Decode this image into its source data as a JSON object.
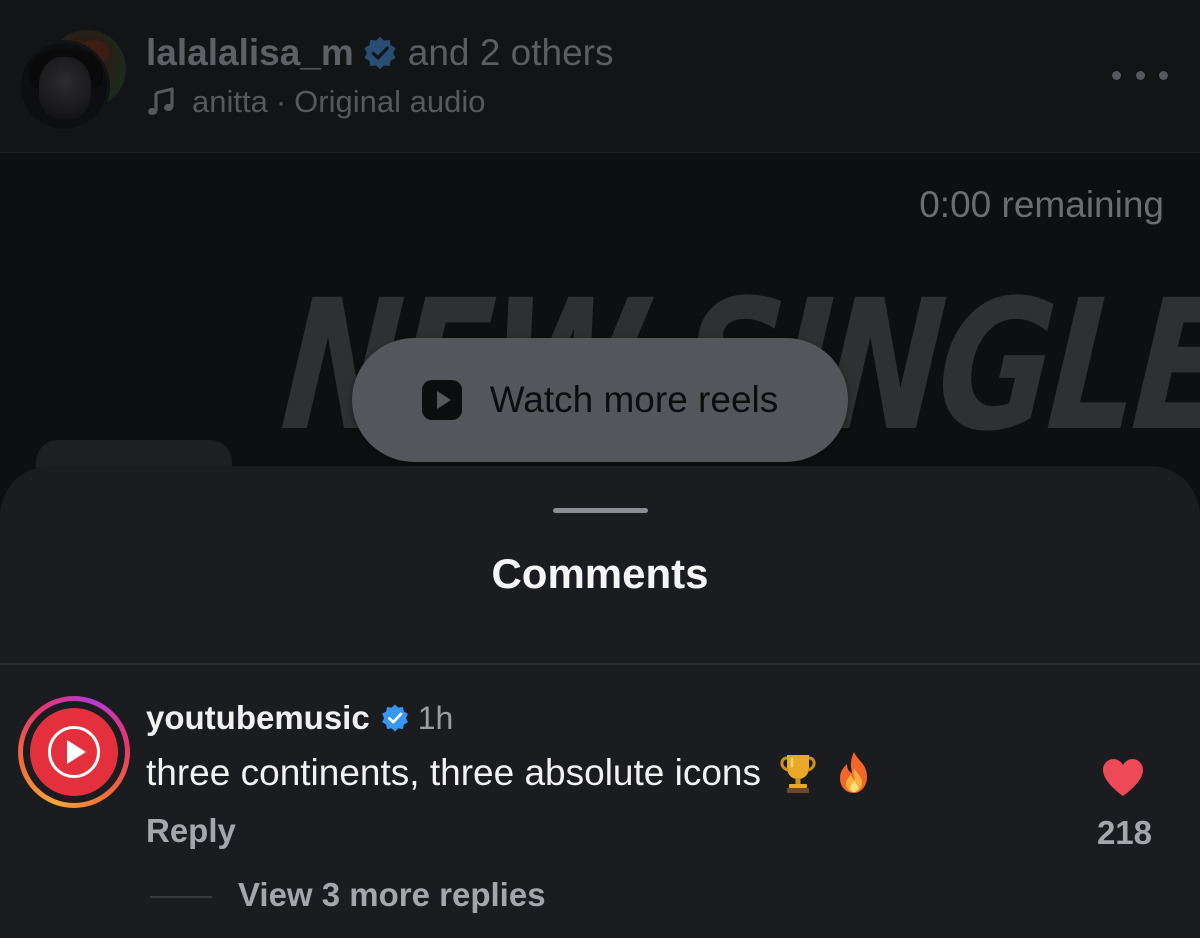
{
  "reel_header": {
    "username": "lalalalisa_m",
    "others_text": "and 2 others",
    "audio_artist": "anitta",
    "audio_separator": "·",
    "audio_title": "Original audio"
  },
  "video": {
    "remaining_text": "0:00 remaining",
    "overlay_text": "NEW SINGLE",
    "watch_more_label": "Watch more reels"
  },
  "comments_sheet": {
    "title": "Comments",
    "comments": [
      {
        "username": "youtubemusic",
        "time": "1h",
        "text": "three continents, three absolute icons",
        "emojis": [
          "trophy-emoji",
          "fire-emoji"
        ],
        "reply_label": "Reply",
        "like_count": "218",
        "view_replies_label": "View 3 more replies"
      }
    ]
  },
  "colors": {
    "verified_blue": "#3897f0",
    "like_red": "#ed4956",
    "sheet_bg": "#1b1c1f"
  }
}
